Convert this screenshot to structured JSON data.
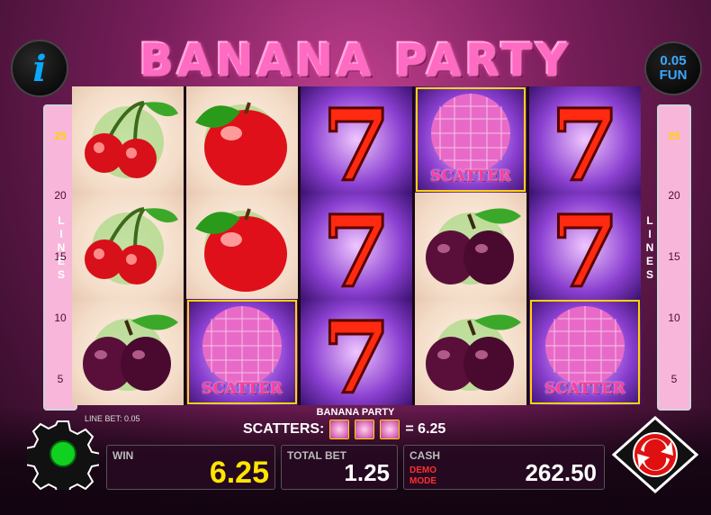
{
  "title": "BANANA PARTY",
  "info_icon": "info-icon",
  "denomination": {
    "value": "0.05",
    "currency": "FUN"
  },
  "lines_label": "LINES",
  "line_numbers": [
    "25",
    "20",
    "15",
    "10",
    "5"
  ],
  "reels": [
    [
      "cherry",
      "cherry",
      "plum"
    ],
    [
      "apple",
      "apple",
      "scatter"
    ],
    [
      "seven",
      "seven",
      "seven"
    ],
    [
      "scatter",
      "plum",
      "plum"
    ],
    [
      "seven",
      "seven",
      "scatter"
    ]
  ],
  "scatter_text": "SCATTER",
  "game_name": "BANANA PARTY",
  "scatters_label": "SCATTERS:",
  "scatters_win": "= 6.25",
  "line_bet_label": "LINE BET: 0.05",
  "win": {
    "label": "WIN",
    "value": "6.25"
  },
  "total_bet": {
    "label": "TOTAL BET",
    "value": "1.25"
  },
  "cash": {
    "label": "CASH",
    "demo": "DEMO MODE",
    "value": "262.50"
  },
  "colors": {
    "accent": "#ff6ac3",
    "win_value": "#ffe600",
    "status_on": "#10d020",
    "info": "#0aa8ff"
  }
}
